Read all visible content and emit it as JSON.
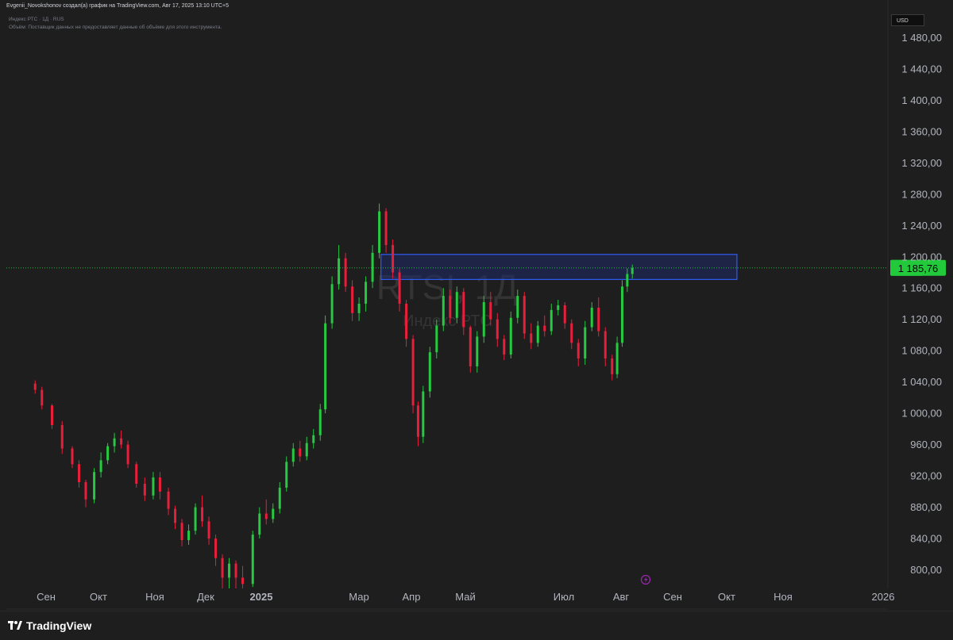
{
  "header": {
    "created_by": "Evgenii_Novokshonov создал(а) график на TradingView.com, Авг 17, 2025 13:10 UTC+5",
    "symbol_line": "Индекс РТС · 1Д · RUS",
    "volume_note": "Объём: Поставщик данных не предоставляет данные об объёме для этого инструмента."
  },
  "currency": "USD",
  "watermark": {
    "ticker": "RTSI, 1Д",
    "name": "Индекс РТС"
  },
  "footer": {
    "logo_text": "TradingView",
    "logo_icon": "tradingview-logo-icon"
  },
  "marker_icon": "lightning-icon",
  "colors": {
    "up": "#26c940",
    "down": "#e81e3b",
    "zone_border": "#2f5cf5",
    "zone_fill": "#1d2a66",
    "price_tag": "#22c93a",
    "price_line": "#22c93a"
  },
  "chart_data": {
    "type": "candlestick",
    "title": "RTSI, 1Д",
    "ylim": [
      768,
      1480
    ],
    "y_ticks": [
      "800,00",
      "840,00",
      "880,00",
      "920,00",
      "960,00",
      "1 000,00",
      "1 040,00",
      "1 080,00",
      "1 120,00",
      "1 160,00",
      "1 200,00",
      "1 240,00",
      "1 280,00",
      "1 320,00",
      "1 360,00",
      "1 400,00",
      "1 440,00",
      "1 480,00"
    ],
    "x_ticks": [
      "Сен",
      "Окт",
      "Ноя",
      "Дек",
      "2025",
      "Мар",
      "Апр",
      "Май",
      "Июл",
      "Авг",
      "Сен",
      "Окт",
      "Ноя",
      "2026"
    ],
    "last_price": 1185.76,
    "last_price_label": "1 185,76",
    "zone": {
      "from": "2025-03-19",
      "to": "2025-10-16",
      "low": 1171,
      "high": 1203
    },
    "candles": [
      {
        "date": "2024-08-26",
        "o": 1038,
        "h": 1042,
        "c": 1030,
        "l": 1025
      },
      {
        "date": "2024-08-30",
        "o": 1030,
        "h": 1034,
        "c": 1010,
        "l": 1005
      },
      {
        "date": "2024-09-05",
        "o": 1010,
        "h": 1012,
        "c": 985,
        "l": 980
      },
      {
        "date": "2024-09-11",
        "o": 985,
        "h": 990,
        "c": 955,
        "l": 948
      },
      {
        "date": "2024-09-17",
        "o": 955,
        "h": 958,
        "c": 935,
        "l": 930
      },
      {
        "date": "2024-09-21",
        "o": 935,
        "h": 940,
        "c": 912,
        "l": 905
      },
      {
        "date": "2024-09-25",
        "o": 912,
        "h": 915,
        "c": 890,
        "l": 880
      },
      {
        "date": "2024-09-30",
        "o": 890,
        "h": 930,
        "c": 925,
        "l": 885
      },
      {
        "date": "2024-10-04",
        "o": 925,
        "h": 950,
        "c": 940,
        "l": 918
      },
      {
        "date": "2024-10-08",
        "o": 940,
        "h": 962,
        "c": 958,
        "l": 935
      },
      {
        "date": "2024-10-12",
        "o": 958,
        "h": 975,
        "c": 968,
        "l": 950
      },
      {
        "date": "2024-10-16",
        "o": 968,
        "h": 978,
        "c": 960,
        "l": 955
      },
      {
        "date": "2024-10-20",
        "o": 960,
        "h": 965,
        "c": 935,
        "l": 930
      },
      {
        "date": "2024-10-25",
        "o": 935,
        "h": 938,
        "c": 910,
        "l": 905
      },
      {
        "date": "2024-10-30",
        "o": 910,
        "h": 918,
        "c": 895,
        "l": 888
      },
      {
        "date": "2024-11-04",
        "o": 895,
        "h": 925,
        "c": 918,
        "l": 890
      },
      {
        "date": "2024-11-08",
        "o": 918,
        "h": 925,
        "c": 900,
        "l": 890
      },
      {
        "date": "2024-11-13",
        "o": 900,
        "h": 905,
        "c": 878,
        "l": 870
      },
      {
        "date": "2024-11-17",
        "o": 878,
        "h": 882,
        "c": 860,
        "l": 852
      },
      {
        "date": "2024-11-21",
        "o": 860,
        "h": 865,
        "c": 838,
        "l": 830
      },
      {
        "date": "2024-11-25",
        "o": 838,
        "h": 858,
        "c": 850,
        "l": 832
      },
      {
        "date": "2024-11-29",
        "o": 850,
        "h": 885,
        "c": 880,
        "l": 845
      },
      {
        "date": "2024-12-03",
        "o": 880,
        "h": 895,
        "c": 862,
        "l": 855
      },
      {
        "date": "2024-12-07",
        "o": 862,
        "h": 868,
        "c": 840,
        "l": 832
      },
      {
        "date": "2024-12-11",
        "o": 840,
        "h": 845,
        "c": 815,
        "l": 805
      },
      {
        "date": "2024-12-15",
        "o": 815,
        "h": 820,
        "c": 790,
        "l": 775
      },
      {
        "date": "2024-12-19",
        "o": 790,
        "h": 815,
        "c": 808,
        "l": 775
      },
      {
        "date": "2024-12-23",
        "o": 808,
        "h": 812,
        "c": 790,
        "l": 775
      },
      {
        "date": "2024-12-27",
        "o": 790,
        "h": 805,
        "c": 782,
        "l": 775
      },
      {
        "date": "2025-01-02",
        "o": 782,
        "h": 850,
        "c": 845,
        "l": 778
      },
      {
        "date": "2025-01-06",
        "o": 845,
        "h": 880,
        "c": 872,
        "l": 840
      },
      {
        "date": "2025-01-10",
        "o": 872,
        "h": 890,
        "c": 865,
        "l": 858
      },
      {
        "date": "2025-01-14",
        "o": 865,
        "h": 885,
        "c": 878,
        "l": 860
      },
      {
        "date": "2025-01-18",
        "o": 878,
        "h": 912,
        "c": 905,
        "l": 872
      },
      {
        "date": "2025-01-22",
        "o": 905,
        "h": 945,
        "c": 938,
        "l": 900
      },
      {
        "date": "2025-01-26",
        "o": 938,
        "h": 962,
        "c": 955,
        "l": 932
      },
      {
        "date": "2025-01-30",
        "o": 955,
        "h": 965,
        "c": 945,
        "l": 938
      },
      {
        "date": "2025-02-03",
        "o": 945,
        "h": 970,
        "c": 962,
        "l": 940
      },
      {
        "date": "2025-02-07",
        "o": 962,
        "h": 980,
        "c": 972,
        "l": 955
      },
      {
        "date": "2025-02-11",
        "o": 972,
        "h": 1012,
        "c": 1005,
        "l": 965
      },
      {
        "date": "2025-02-14",
        "o": 1005,
        "h": 1125,
        "c": 1115,
        "l": 1000
      },
      {
        "date": "2025-02-18",
        "o": 1115,
        "h": 1175,
        "c": 1165,
        "l": 1108
      },
      {
        "date": "2025-02-22",
        "o": 1165,
        "h": 1215,
        "c": 1198,
        "l": 1158
      },
      {
        "date": "2025-02-26",
        "o": 1198,
        "h": 1205,
        "c": 1162,
        "l": 1155
      },
      {
        "date": "2025-03-02",
        "o": 1162,
        "h": 1170,
        "c": 1128,
        "l": 1118
      },
      {
        "date": "2025-03-06",
        "o": 1128,
        "h": 1148,
        "c": 1140,
        "l": 1118
      },
      {
        "date": "2025-03-10",
        "o": 1140,
        "h": 1175,
        "c": 1168,
        "l": 1130
      },
      {
        "date": "2025-03-14",
        "o": 1168,
        "h": 1215,
        "c": 1205,
        "l": 1160
      },
      {
        "date": "2025-03-18",
        "o": 1205,
        "h": 1268,
        "c": 1258,
        "l": 1198
      },
      {
        "date": "2025-03-22",
        "o": 1258,
        "h": 1262,
        "c": 1215,
        "l": 1205
      },
      {
        "date": "2025-03-26",
        "o": 1215,
        "h": 1222,
        "c": 1180,
        "l": 1172
      },
      {
        "date": "2025-03-30",
        "o": 1180,
        "h": 1185,
        "c": 1140,
        "l": 1130
      },
      {
        "date": "2025-04-03",
        "o": 1140,
        "h": 1145,
        "c": 1095,
        "l": 1085
      },
      {
        "date": "2025-04-07",
        "o": 1095,
        "h": 1100,
        "c": 1010,
        "l": 1000
      },
      {
        "date": "2025-04-10",
        "o": 1010,
        "h": 1015,
        "c": 970,
        "l": 958
      },
      {
        "date": "2025-04-13",
        "o": 970,
        "h": 1035,
        "c": 1028,
        "l": 962
      },
      {
        "date": "2025-04-17",
        "o": 1028,
        "h": 1085,
        "c": 1078,
        "l": 1020
      },
      {
        "date": "2025-04-21",
        "o": 1078,
        "h": 1120,
        "c": 1112,
        "l": 1070
      },
      {
        "date": "2025-04-25",
        "o": 1112,
        "h": 1160,
        "c": 1150,
        "l": 1105
      },
      {
        "date": "2025-04-29",
        "o": 1150,
        "h": 1158,
        "c": 1122,
        "l": 1115
      },
      {
        "date": "2025-05-03",
        "o": 1122,
        "h": 1162,
        "c": 1155,
        "l": 1115
      },
      {
        "date": "2025-05-07",
        "o": 1155,
        "h": 1160,
        "c": 1110,
        "l": 1100
      },
      {
        "date": "2025-05-11",
        "o": 1110,
        "h": 1112,
        "c": 1060,
        "l": 1052
      },
      {
        "date": "2025-05-15",
        "o": 1060,
        "h": 1105,
        "c": 1098,
        "l": 1052
      },
      {
        "date": "2025-05-19",
        "o": 1098,
        "h": 1150,
        "c": 1142,
        "l": 1090
      },
      {
        "date": "2025-05-23",
        "o": 1142,
        "h": 1155,
        "c": 1120,
        "l": 1112
      },
      {
        "date": "2025-05-27",
        "o": 1120,
        "h": 1128,
        "c": 1095,
        "l": 1085
      },
      {
        "date": "2025-05-31",
        "o": 1095,
        "h": 1100,
        "c": 1075,
        "l": 1068
      },
      {
        "date": "2025-06-04",
        "o": 1075,
        "h": 1130,
        "c": 1122,
        "l": 1070
      },
      {
        "date": "2025-06-08",
        "o": 1122,
        "h": 1158,
        "c": 1150,
        "l": 1115
      },
      {
        "date": "2025-06-12",
        "o": 1150,
        "h": 1155,
        "c": 1102,
        "l": 1095
      },
      {
        "date": "2025-06-16",
        "o": 1102,
        "h": 1115,
        "c": 1090,
        "l": 1082
      },
      {
        "date": "2025-06-20",
        "o": 1090,
        "h": 1118,
        "c": 1112,
        "l": 1085
      },
      {
        "date": "2025-06-24",
        "o": 1112,
        "h": 1125,
        "c": 1105,
        "l": 1098
      },
      {
        "date": "2025-06-28",
        "o": 1105,
        "h": 1140,
        "c": 1132,
        "l": 1100
      },
      {
        "date": "2025-07-02",
        "o": 1132,
        "h": 1145,
        "c": 1138,
        "l": 1125
      },
      {
        "date": "2025-07-06",
        "o": 1138,
        "h": 1142,
        "c": 1115,
        "l": 1108
      },
      {
        "date": "2025-07-10",
        "o": 1115,
        "h": 1120,
        "c": 1090,
        "l": 1082
      },
      {
        "date": "2025-07-14",
        "o": 1090,
        "h": 1095,
        "c": 1070,
        "l": 1060
      },
      {
        "date": "2025-07-18",
        "o": 1070,
        "h": 1118,
        "c": 1110,
        "l": 1062
      },
      {
        "date": "2025-07-22",
        "o": 1110,
        "h": 1142,
        "c": 1135,
        "l": 1105
      },
      {
        "date": "2025-07-26",
        "o": 1135,
        "h": 1148,
        "c": 1105,
        "l": 1098
      },
      {
        "date": "2025-07-30",
        "o": 1105,
        "h": 1110,
        "c": 1070,
        "l": 1060
      },
      {
        "date": "2025-08-03",
        "o": 1070,
        "h": 1075,
        "c": 1050,
        "l": 1042
      },
      {
        "date": "2025-08-06",
        "o": 1050,
        "h": 1098,
        "c": 1090,
        "l": 1045
      },
      {
        "date": "2025-08-09",
        "o": 1090,
        "h": 1170,
        "c": 1162,
        "l": 1085
      },
      {
        "date": "2025-08-12",
        "o": 1162,
        "h": 1185,
        "c": 1178,
        "l": 1155
      },
      {
        "date": "2025-08-15",
        "o": 1178,
        "h": 1190,
        "c": 1185.76,
        "l": 1172
      }
    ]
  }
}
